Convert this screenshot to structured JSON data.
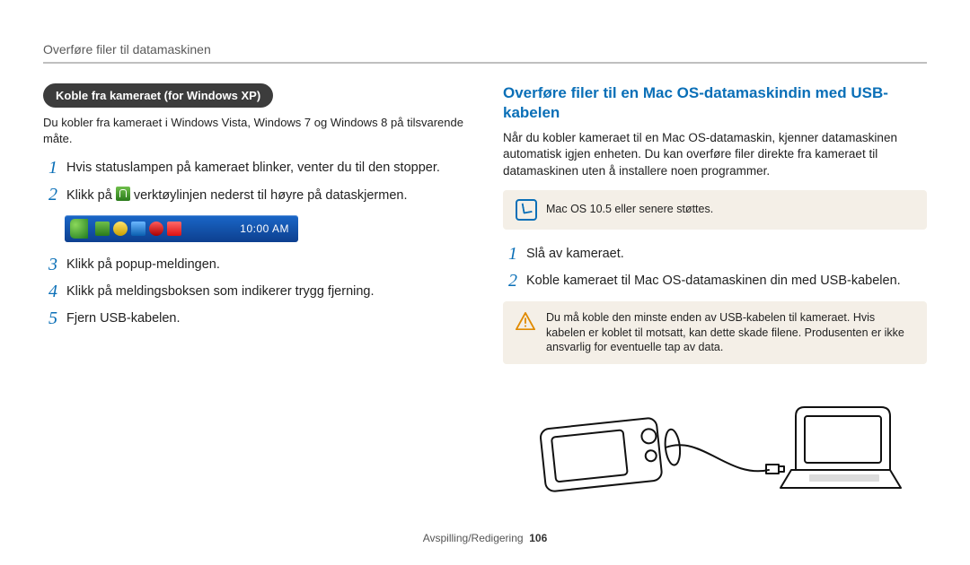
{
  "breadcrumb": "Overføre filer til datamaskinen",
  "left": {
    "pill": "Koble fra kameraet (for Windows XP)",
    "intro": "Du kobler fra kameraet i Windows Vista, Windows 7 og Windows 8 på tilsvarende måte.",
    "steps": [
      {
        "n": "1",
        "text": "Hvis statuslampen på kameraet blinker, venter du til den stopper."
      },
      {
        "n": "2",
        "pre": "Klikk på ",
        "post": " verktøylinjen nederst til høyre på dataskjermen."
      },
      {
        "n": "3",
        "text": "Klikk på popup-meldingen."
      },
      {
        "n": "4",
        "text": "Klikk på meldingsboksen som indikerer trygg fjerning."
      },
      {
        "n": "5",
        "text": "Fjern USB-kabelen."
      }
    ],
    "taskbar_time": "10:00 AM"
  },
  "right": {
    "heading": "Overføre filer til en Mac OS-datamaskindin med USB-kabelen",
    "para": "Når du kobler kameraet til en Mac OS-datamaskin, kjenner datamaskinen automatisk igjen enheten. Du kan overføre filer direkte fra kameraet til datamaskinen uten å installere noen programmer.",
    "note": "Mac OS 10.5 eller senere støttes.",
    "steps": [
      {
        "n": "1",
        "text": "Slå av kameraet."
      },
      {
        "n": "2",
        "text": "Koble kameraet til Mac OS-datamaskinen din med USB-kabelen."
      }
    ],
    "warn": "Du må koble den minste enden av USB-kabelen til kameraet. Hvis kabelen er koblet til motsatt, kan dette skade filene. Produsenten er ikke ansvarlig for eventuelle tap av data."
  },
  "footer": {
    "section": "Avspilling/Redigering",
    "page": "106"
  }
}
